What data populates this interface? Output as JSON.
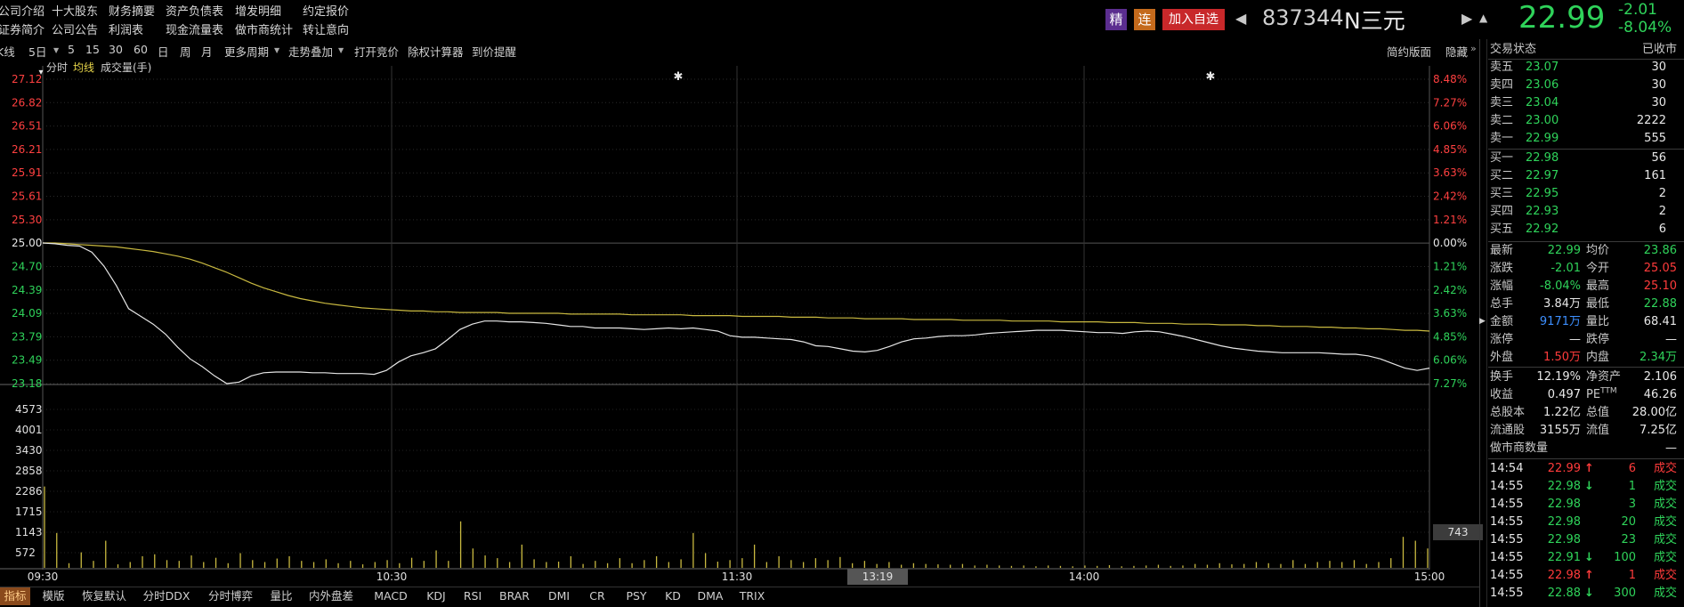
{
  "menu": {
    "row1": [
      "公司介绍",
      "十大股东",
      "财务摘要",
      "资产负债表",
      "增发明细",
      "约定报价"
    ],
    "row2": [
      "证券简介",
      "公司公告",
      "利润表",
      "现金流量表",
      "做市商统计",
      "转让意向"
    ]
  },
  "header": {
    "badge_jing": "精",
    "badge_lian": "连",
    "add_watch": "加入自选",
    "code": "837344",
    "name": "N三元",
    "price": "22.99",
    "change": "-2.01",
    "change_pct": "-8.04%"
  },
  "toolbar": {
    "items": [
      "K线",
      "5日",
      "5",
      "15",
      "30",
      "60",
      "日",
      "周",
      "月",
      "更多周期",
      "走势叠加",
      "打开竞价",
      "除权计算器",
      "到价提醒"
    ],
    "right": [
      "简约版面",
      "隐藏"
    ]
  },
  "chart_tabs": [
    "分时",
    "均线",
    "成交量(手)"
  ],
  "price_axis": {
    "left": [
      "27.12",
      "26.82",
      "26.51",
      "26.21",
      "25.91",
      "25.61",
      "25.30",
      "25.00",
      "24.70",
      "24.39",
      "24.09",
      "23.79",
      "23.49",
      "23.18"
    ],
    "right": [
      "8.48%",
      "7.27%",
      "6.06%",
      "4.85%",
      "3.63%",
      "2.42%",
      "1.21%",
      "0.00%",
      "1.21%",
      "2.42%",
      "3.63%",
      "4.85%",
      "6.06%",
      "7.27%"
    ]
  },
  "volume_axis": [
    "4573",
    "4001",
    "3430",
    "2858",
    "2286",
    "1715",
    "1143",
    "572"
  ],
  "volume_current": "743",
  "time_axis": [
    "09:30",
    "10:30",
    "11:30",
    "14:00",
    "15:00"
  ],
  "cursor_time": "13:19",
  "bottom_tabs": [
    "指标",
    "模版",
    "恢复默认",
    "分时DDX",
    "分时博弈",
    "量比",
    "内外盘差",
    "MACD",
    "KDJ",
    "RSI",
    "BRAR",
    "DMI",
    "CR",
    "PSY",
    "KD",
    "DMA",
    "TRIX"
  ],
  "side_panel": {
    "title": "交易状态",
    "status": "已收市",
    "asks": [
      {
        "label": "卖五",
        "price": "23.07",
        "vol": "30"
      },
      {
        "label": "卖四",
        "price": "23.06",
        "vol": "30"
      },
      {
        "label": "卖三",
        "price": "23.04",
        "vol": "30"
      },
      {
        "label": "卖二",
        "price": "23.00",
        "vol": "2222"
      },
      {
        "label": "卖一",
        "price": "22.99",
        "vol": "555"
      }
    ],
    "bids": [
      {
        "label": "买一",
        "price": "22.98",
        "vol": "56"
      },
      {
        "label": "买二",
        "price": "22.97",
        "vol": "161"
      },
      {
        "label": "买三",
        "price": "22.95",
        "vol": "2"
      },
      {
        "label": "买四",
        "price": "22.93",
        "vol": "2"
      },
      {
        "label": "买五",
        "price": "22.92",
        "vol": "6"
      }
    ],
    "stats": [
      {
        "l1": "最新",
        "v1": "22.99",
        "c1": "green",
        "l2": "均价",
        "v2": "23.86",
        "c2": "green"
      },
      {
        "l1": "涨跌",
        "v1": "-2.01",
        "c1": "green",
        "l2": "今开",
        "v2": "25.05",
        "c2": "red"
      },
      {
        "l1": "涨幅",
        "v1": "-8.04%",
        "c1": "green",
        "l2": "最高",
        "v2": "25.10",
        "c2": "red"
      },
      {
        "l1": "总手",
        "v1": "3.84万",
        "c1": "white",
        "l2": "最低",
        "v2": "22.88",
        "c2": "green"
      },
      {
        "l1": "金额",
        "v1": "9171万",
        "c1": "blue",
        "l2": "量比",
        "v2": "68.41",
        "c2": "white"
      },
      {
        "l1": "涨停",
        "v1": "—",
        "c1": "white",
        "l2": "跌停",
        "v2": "—",
        "c2": "white"
      },
      {
        "l1": "外盘",
        "v1": "1.50万",
        "c1": "red",
        "l2": "内盘",
        "v2": "2.34万",
        "c2": "green"
      },
      {
        "l1": "换手",
        "v1": "12.19%",
        "c1": "white",
        "l2": "净资产",
        "v2": "2.106",
        "c2": "white"
      },
      {
        "l1": "收益",
        "v1": "0.497",
        "c1": "white",
        "l2": "PE",
        "v2": "46.26",
        "c2": "white"
      },
      {
        "l1": "总股本",
        "v1": "1.22亿",
        "c1": "white",
        "l2": "总值",
        "v2": "28.00亿",
        "c2": "white"
      },
      {
        "l1": "流通股",
        "v1": "3155万",
        "c1": "white",
        "l2": "流值",
        "v2": "7.25亿",
        "c2": "white"
      }
    ],
    "pe_sup": "TTM",
    "market_maker_label": "做市商数量",
    "market_maker_value": "—",
    "trades": [
      {
        "time": "14:54",
        "price": "22.99",
        "arrow": "↑",
        "vol": "6",
        "label": "成交",
        "c": "red"
      },
      {
        "time": "14:55",
        "price": "22.98",
        "arrow": "↓",
        "vol": "1",
        "label": "成交",
        "c": "green"
      },
      {
        "time": "14:55",
        "price": "22.98",
        "arrow": "",
        "vol": "3",
        "label": "成交",
        "c": "green"
      },
      {
        "time": "14:55",
        "price": "22.98",
        "arrow": "",
        "vol": "20",
        "label": "成交",
        "c": "green"
      },
      {
        "time": "14:55",
        "price": "22.98",
        "arrow": "",
        "vol": "23",
        "label": "成交",
        "c": "green"
      },
      {
        "time": "14:55",
        "price": "22.91",
        "arrow": "↓",
        "vol": "100",
        "label": "成交",
        "c": "green"
      },
      {
        "time": "14:55",
        "price": "22.98",
        "arrow": "↑",
        "vol": "1",
        "label": "成交",
        "c": "red"
      },
      {
        "time": "14:55",
        "price": "22.88",
        "arrow": "↓",
        "vol": "300",
        "label": "成交",
        "c": "green"
      }
    ]
  },
  "chart_data": {
    "type": "line",
    "title": "",
    "xlabel": "",
    "ylabel": "",
    "x_ticks": [
      "09:30",
      "10:30",
      "11:30",
      "14:00",
      "15:00"
    ],
    "ylim": [
      23.18,
      27.12
    ],
    "prev_close": 25.0,
    "series": [
      {
        "values": [
          25.0,
          24.99,
          24.97,
          24.96,
          24.88,
          24.7,
          24.45,
          24.15,
          24.05,
          23.95,
          23.82,
          23.65,
          23.5,
          23.4,
          23.28,
          23.18,
          23.2,
          23.28,
          23.32,
          23.33,
          23.33,
          23.33,
          23.32,
          23.32,
          23.31,
          23.31,
          23.31,
          23.3,
          23.35,
          23.46,
          23.54,
          23.58,
          23.63,
          23.75,
          23.88,
          23.95,
          23.99,
          23.99,
          23.98,
          23.98,
          23.97,
          23.96,
          23.94,
          23.92,
          23.92,
          23.9,
          23.9,
          23.9,
          23.89,
          23.88,
          23.89,
          23.9,
          23.89,
          23.9,
          23.88,
          23.86,
          23.8,
          23.78,
          23.78,
          23.77,
          23.76,
          23.75,
          23.72,
          23.67,
          23.66,
          23.63,
          23.6,
          23.59,
          23.61,
          23.66,
          23.72,
          23.76,
          23.77,
          23.79,
          23.8,
          23.8,
          23.81,
          23.83,
          23.84,
          23.85,
          23.86,
          23.87,
          23.87,
          23.87,
          23.86,
          23.85,
          23.84,
          23.84,
          23.83,
          23.85,
          23.86,
          23.85,
          23.82,
          23.79,
          23.75,
          23.71,
          23.67,
          23.64,
          23.62,
          23.6,
          23.59,
          23.58,
          23.58,
          23.58,
          23.58,
          23.57,
          23.56,
          23.56,
          23.54,
          23.5,
          23.44,
          23.38,
          23.35,
          23.38
        ]
      },
      {
        "values": [
          25.0,
          25.0,
          24.99,
          24.98,
          24.97,
          24.96,
          24.95,
          24.93,
          24.91,
          24.89,
          24.86,
          24.83,
          24.79,
          24.74,
          24.68,
          24.62,
          24.55,
          24.48,
          24.42,
          24.37,
          24.32,
          24.28,
          24.25,
          24.22,
          24.2,
          24.18,
          24.16,
          24.15,
          24.14,
          24.13,
          24.12,
          24.12,
          24.11,
          24.11,
          24.1,
          24.1,
          24.1,
          24.1,
          24.09,
          24.09,
          24.09,
          24.09,
          24.09,
          24.08,
          24.08,
          24.08,
          24.08,
          24.08,
          24.07,
          24.07,
          24.07,
          24.07,
          24.07,
          24.06,
          24.06,
          24.06,
          24.06,
          24.05,
          24.05,
          24.05,
          24.05,
          24.04,
          24.04,
          24.04,
          24.03,
          24.03,
          24.03,
          24.02,
          24.02,
          24.02,
          24.02,
          24.01,
          24.01,
          24.01,
          24.01,
          24.0,
          24.0,
          24.0,
          24.0,
          23.99,
          23.99,
          23.99,
          23.99,
          23.98,
          23.98,
          23.98,
          23.98,
          23.97,
          23.97,
          23.97,
          23.96,
          23.96,
          23.96,
          23.95,
          23.95,
          23.95,
          23.94,
          23.94,
          23.94,
          23.93,
          23.93,
          23.92,
          23.92,
          23.92,
          23.91,
          23.91,
          23.9,
          23.9,
          23.89,
          23.89,
          23.88,
          23.87,
          23.87,
          23.86
        ]
      }
    ],
    "volume": {
      "ylim": [
        0,
        4573
      ],
      "values": [
        2100,
        900,
        120,
        400,
        180,
        700,
        90,
        150,
        300,
        350,
        200,
        180,
        320,
        150,
        260,
        120,
        380,
        200,
        150,
        240,
        300,
        180,
        150,
        220,
        120,
        180,
        90,
        150,
        200,
        120,
        260,
        180,
        450,
        180,
        1200,
        500,
        320,
        250,
        150,
        600,
        220,
        150,
        160,
        300,
        100,
        180,
        120,
        250,
        120,
        200,
        300,
        150,
        220,
        900,
        380,
        160,
        200,
        250,
        600,
        150,
        300,
        200,
        150,
        250,
        200,
        280,
        120,
        180,
        100,
        150,
        80,
        120,
        100,
        90,
        80,
        100,
        60,
        80,
        60,
        50,
        60,
        40,
        60,
        50,
        40,
        60,
        50,
        70,
        40,
        50,
        60,
        80,
        50,
        60,
        100,
        80,
        120,
        90,
        100,
        150,
        120,
        100,
        200,
        100,
        150,
        180,
        150,
        200,
        100,
        150,
        250,
        800,
        700,
        500
      ]
    }
  }
}
